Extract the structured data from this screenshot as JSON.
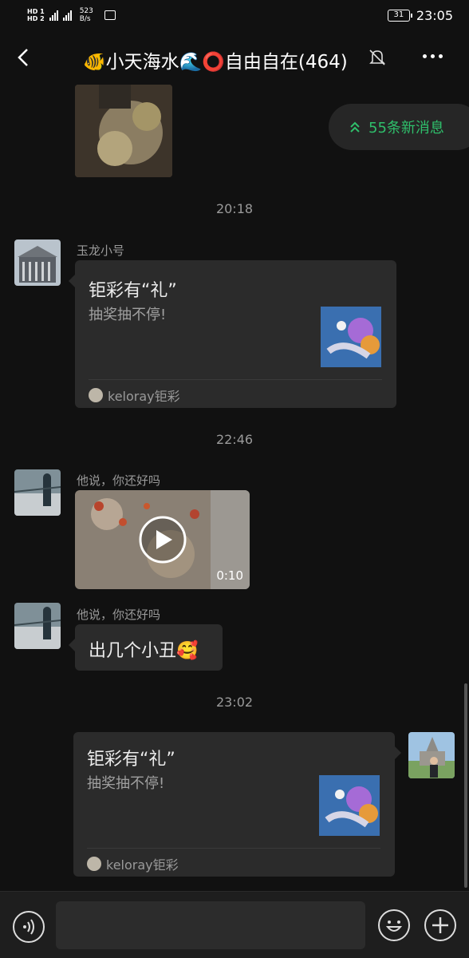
{
  "status": {
    "hd1": "HD 1",
    "hd2": "HD 2",
    "net_speed": "523",
    "net_unit": "B/s",
    "battery": "31",
    "time": "23:05"
  },
  "header": {
    "title": "🐠小天海水🌊⭕自由自在(464)"
  },
  "new_messages": {
    "label": "55条新消息"
  },
  "timestamps": [
    "20:18",
    "22:46",
    "23:02"
  ],
  "messages": [
    {
      "sender": "玉龙小号",
      "card_title": "钜彩有“礼”",
      "card_desc": "抽奖抽不停!",
      "card_source": "keloray钜彩"
    },
    {
      "sender": "他说，你还好吗",
      "video_duration": "0:10"
    },
    {
      "sender": "他说，你还好吗",
      "text": "出几个小丑🥰"
    },
    {
      "card_title": "钜彩有“礼”",
      "card_desc": "抽奖抽不停!",
      "card_source": "keloray钜彩"
    }
  ],
  "colors": {
    "background": "#111111",
    "bubble": "#2b2b2b",
    "accent_green": "#2fbf6b"
  }
}
